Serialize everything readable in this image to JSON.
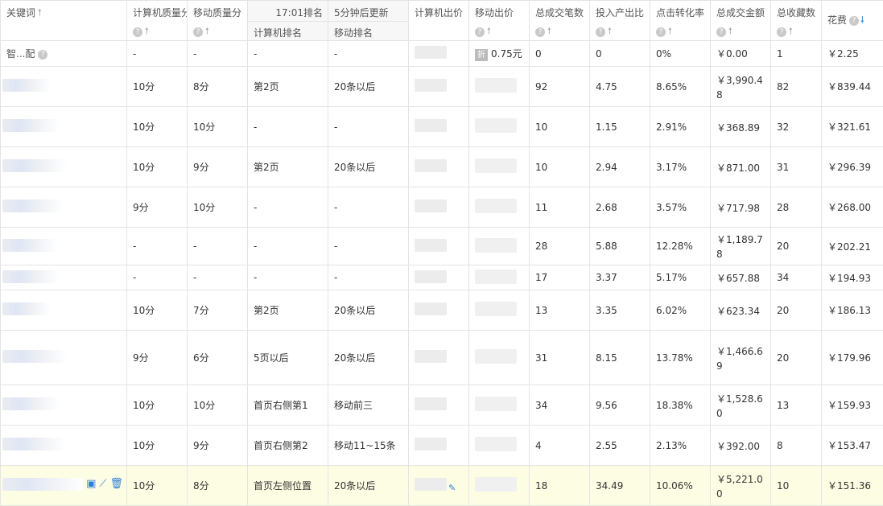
{
  "header": {
    "keyword": "关键词",
    "pc_quality": "计算机质量分",
    "mobile_quality": "移动质量分",
    "rank_time": "17:01排名",
    "rank_refresh": "5分钟后更新",
    "pc_rank": "计算机排名",
    "mobile_rank": "移动排名",
    "pc_bid": "计算机出价",
    "mobile_bid": "移动出价",
    "total_deals": "总成交笔数",
    "roi": "投入产出比",
    "ctr_conv": "点击转化率",
    "total_amount": "总成交金额",
    "total_fav": "总收藏数",
    "cost": "花费"
  },
  "first_row": {
    "keyword": "智...配",
    "pc_quality": "-",
    "mobile_quality": "-",
    "pc_rank": "-",
    "mobile_rank": "-",
    "discount_badge": "折",
    "mobile_bid": "0.75元",
    "total_deals": "0",
    "roi": "0",
    "ctr_conv": "0%",
    "total_amount": "￥0.00",
    "total_fav": "1",
    "cost": "￥2.25"
  },
  "rows": [
    {
      "pc_quality": "10分",
      "mobile_quality": "8分",
      "pc_rank": "第2页",
      "mobile_rank": "20条以后",
      "total_deals": "92",
      "roi": "4.75",
      "ctr_conv": "8.65%",
      "amount_l1": "￥3,990.4",
      "amount_l2": "8",
      "total_fav": "82",
      "cost": "￥839.44"
    },
    {
      "pc_quality": "10分",
      "mobile_quality": "10分",
      "pc_rank": "-",
      "mobile_rank": "-",
      "total_deals": "10",
      "roi": "1.15",
      "ctr_conv": "2.91%",
      "amount_l1": "￥368.89",
      "amount_l2": "",
      "total_fav": "32",
      "cost": "￥321.61"
    },
    {
      "pc_quality": "10分",
      "mobile_quality": "9分",
      "pc_rank": "第2页",
      "mobile_rank": "20条以后",
      "total_deals": "10",
      "roi": "2.94",
      "ctr_conv": "3.17%",
      "amount_l1": "￥871.00",
      "amount_l2": "",
      "total_fav": "31",
      "cost": "￥296.39"
    },
    {
      "pc_quality": "9分",
      "mobile_quality": "10分",
      "pc_rank": "-",
      "mobile_rank": "-",
      "total_deals": "11",
      "roi": "2.68",
      "ctr_conv": "3.57%",
      "amount_l1": "￥717.98",
      "amount_l2": "",
      "total_fav": "28",
      "cost": "￥268.00"
    },
    {
      "pc_quality": "-",
      "mobile_quality": "-",
      "pc_rank": "-",
      "mobile_rank": "-",
      "total_deals": "28",
      "roi": "5.88",
      "ctr_conv": "12.28%",
      "amount_l1": "￥1,189.7",
      "amount_l2": "8",
      "total_fav": "20",
      "cost": "￥202.21"
    },
    {
      "pc_quality": "-",
      "mobile_quality": "-",
      "pc_rank": "-",
      "mobile_rank": "-",
      "total_deals": "17",
      "roi": "3.37",
      "ctr_conv": "5.17%",
      "amount_l1": "￥657.88",
      "amount_l2": "",
      "total_fav": "34",
      "cost": "￥194.93"
    },
    {
      "pc_quality": "10分",
      "mobile_quality": "7分",
      "pc_rank": "第2页",
      "mobile_rank": "20条以后",
      "total_deals": "13",
      "roi": "3.35",
      "ctr_conv": "6.02%",
      "amount_l1": "￥623.34",
      "amount_l2": "",
      "total_fav": "20",
      "cost": "￥186.13"
    },
    {
      "pc_quality": "9分",
      "mobile_quality": "6分",
      "pc_rank": "5页以后",
      "mobile_rank": "20条以后",
      "total_deals": "31",
      "roi": "8.15",
      "ctr_conv": "13.78%",
      "amount_l1": "￥1,466.6",
      "amount_l2": "9",
      "total_fav": "20",
      "cost": "￥179.96"
    },
    {
      "pc_quality": "10分",
      "mobile_quality": "10分",
      "pc_rank": "首页右侧第1",
      "mobile_rank": "移动前三",
      "total_deals": "34",
      "roi": "9.56",
      "ctr_conv": "18.38%",
      "amount_l1": "￥1,528.6",
      "amount_l2": "0",
      "total_fav": "13",
      "cost": "￥159.93"
    },
    {
      "pc_quality": "10分",
      "mobile_quality": "9分",
      "pc_rank": "首页右侧第2",
      "mobile_rank": "移动11~15条",
      "total_deals": "4",
      "roi": "2.55",
      "ctr_conv": "2.13%",
      "amount_l1": "￥392.00",
      "amount_l2": "",
      "total_fav": "8",
      "cost": "￥153.47"
    },
    {
      "pc_quality": "10分",
      "mobile_quality": "8分",
      "pc_rank": "首页左侧位置",
      "mobile_rank": "20条以后",
      "total_deals": "18",
      "roi": "34.49",
      "ctr_conv": "10.06%",
      "amount_l1": "￥5,221.0",
      "amount_l2": "0",
      "total_fav": "10",
      "cost": "￥151.36"
    }
  ],
  "icons": {
    "sort_up": "up-arrow-icon",
    "sort_down": "down-arrow-icon",
    "help": "question-icon",
    "stats": "chart-icon",
    "trend": "trend-line-icon",
    "delete": "trash-icon",
    "edit": "pencil-icon"
  },
  "colors": {
    "accent": "#2f7fd8",
    "highlight_row": "#fdfde4",
    "border": "#e4e4e4"
  }
}
